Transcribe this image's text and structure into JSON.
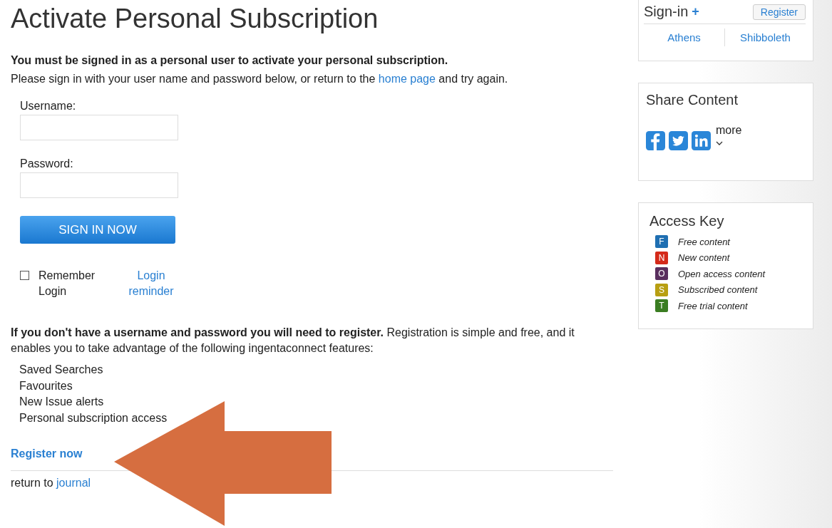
{
  "page_title": "Activate Personal Subscription",
  "notice": "You must be signed in as a personal user to activate your personal subscription.",
  "instructions": {
    "before": "Please sign in with your user name and password below, or return to the",
    "link": "home page",
    "after": "and try again."
  },
  "form": {
    "username_label": "Username:",
    "password_label": "Password:",
    "submit": "SIGN IN NOW",
    "remember": {
      "label": "Remember Login",
      "checked": false
    },
    "reminder_link": "Login reminder"
  },
  "register_text": "**If you don't have a username and password you will need to register.** Registration is simple and free, and it enables you to take advantage of the following ingentaconnect features:",
  "features": [
    "Saved Searches",
    "Favourites",
    "New Issue alerts",
    "Personal subscription access"
  ],
  "register_link": "Register now",
  "footer": {
    "before": "return to",
    "link": "journal"
  },
  "signin_box": {
    "title": "Sign-in",
    "plus": "+",
    "register": "Register",
    "links": [
      "Athens",
      "Shibboleth"
    ]
  },
  "share_box": {
    "title": "Share Content",
    "more": "more"
  },
  "access_key": {
    "title": "Access Key",
    "items": [
      {
        "letter": "F",
        "label": "Free content",
        "color": "#1f6fb2"
      },
      {
        "letter": "N",
        "label": "New content",
        "color": "#d42a1a"
      },
      {
        "letter": "O",
        "label": "Open access content",
        "color": "#5a2f5e"
      },
      {
        "letter": "S",
        "label": "Subscribed content",
        "color": "#b89f12"
      },
      {
        "letter": "T",
        "label": "Free trial content",
        "color": "#3a7d22"
      }
    ]
  }
}
